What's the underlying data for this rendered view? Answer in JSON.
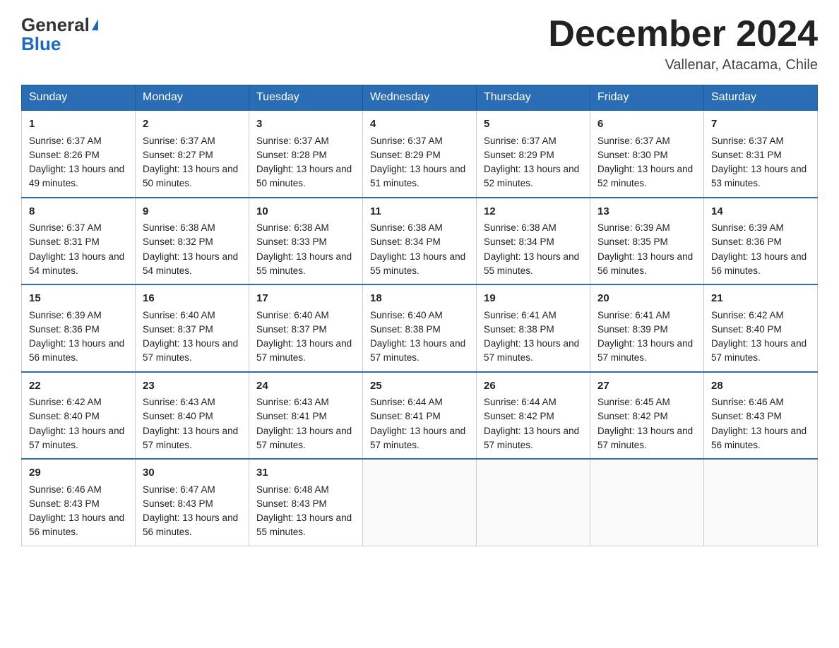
{
  "header": {
    "logo_general": "General",
    "logo_blue": "Blue",
    "month_title": "December 2024",
    "location": "Vallenar, Atacama, Chile"
  },
  "days_of_week": [
    "Sunday",
    "Monday",
    "Tuesday",
    "Wednesday",
    "Thursday",
    "Friday",
    "Saturday"
  ],
  "weeks": [
    [
      {
        "day": "1",
        "sunrise": "6:37 AM",
        "sunset": "8:26 PM",
        "daylight": "13 hours and 49 minutes."
      },
      {
        "day": "2",
        "sunrise": "6:37 AM",
        "sunset": "8:27 PM",
        "daylight": "13 hours and 50 minutes."
      },
      {
        "day": "3",
        "sunrise": "6:37 AM",
        "sunset": "8:28 PM",
        "daylight": "13 hours and 50 minutes."
      },
      {
        "day": "4",
        "sunrise": "6:37 AM",
        "sunset": "8:29 PM",
        "daylight": "13 hours and 51 minutes."
      },
      {
        "day": "5",
        "sunrise": "6:37 AM",
        "sunset": "8:29 PM",
        "daylight": "13 hours and 52 minutes."
      },
      {
        "day": "6",
        "sunrise": "6:37 AM",
        "sunset": "8:30 PM",
        "daylight": "13 hours and 52 minutes."
      },
      {
        "day": "7",
        "sunrise": "6:37 AM",
        "sunset": "8:31 PM",
        "daylight": "13 hours and 53 minutes."
      }
    ],
    [
      {
        "day": "8",
        "sunrise": "6:37 AM",
        "sunset": "8:31 PM",
        "daylight": "13 hours and 54 minutes."
      },
      {
        "day": "9",
        "sunrise": "6:38 AM",
        "sunset": "8:32 PM",
        "daylight": "13 hours and 54 minutes."
      },
      {
        "day": "10",
        "sunrise": "6:38 AM",
        "sunset": "8:33 PM",
        "daylight": "13 hours and 55 minutes."
      },
      {
        "day": "11",
        "sunrise": "6:38 AM",
        "sunset": "8:34 PM",
        "daylight": "13 hours and 55 minutes."
      },
      {
        "day": "12",
        "sunrise": "6:38 AM",
        "sunset": "8:34 PM",
        "daylight": "13 hours and 55 minutes."
      },
      {
        "day": "13",
        "sunrise": "6:39 AM",
        "sunset": "8:35 PM",
        "daylight": "13 hours and 56 minutes."
      },
      {
        "day": "14",
        "sunrise": "6:39 AM",
        "sunset": "8:36 PM",
        "daylight": "13 hours and 56 minutes."
      }
    ],
    [
      {
        "day": "15",
        "sunrise": "6:39 AM",
        "sunset": "8:36 PM",
        "daylight": "13 hours and 56 minutes."
      },
      {
        "day": "16",
        "sunrise": "6:40 AM",
        "sunset": "8:37 PM",
        "daylight": "13 hours and 57 minutes."
      },
      {
        "day": "17",
        "sunrise": "6:40 AM",
        "sunset": "8:37 PM",
        "daylight": "13 hours and 57 minutes."
      },
      {
        "day": "18",
        "sunrise": "6:40 AM",
        "sunset": "8:38 PM",
        "daylight": "13 hours and 57 minutes."
      },
      {
        "day": "19",
        "sunrise": "6:41 AM",
        "sunset": "8:38 PM",
        "daylight": "13 hours and 57 minutes."
      },
      {
        "day": "20",
        "sunrise": "6:41 AM",
        "sunset": "8:39 PM",
        "daylight": "13 hours and 57 minutes."
      },
      {
        "day": "21",
        "sunrise": "6:42 AM",
        "sunset": "8:40 PM",
        "daylight": "13 hours and 57 minutes."
      }
    ],
    [
      {
        "day": "22",
        "sunrise": "6:42 AM",
        "sunset": "8:40 PM",
        "daylight": "13 hours and 57 minutes."
      },
      {
        "day": "23",
        "sunrise": "6:43 AM",
        "sunset": "8:40 PM",
        "daylight": "13 hours and 57 minutes."
      },
      {
        "day": "24",
        "sunrise": "6:43 AM",
        "sunset": "8:41 PM",
        "daylight": "13 hours and 57 minutes."
      },
      {
        "day": "25",
        "sunrise": "6:44 AM",
        "sunset": "8:41 PM",
        "daylight": "13 hours and 57 minutes."
      },
      {
        "day": "26",
        "sunrise": "6:44 AM",
        "sunset": "8:42 PM",
        "daylight": "13 hours and 57 minutes."
      },
      {
        "day": "27",
        "sunrise": "6:45 AM",
        "sunset": "8:42 PM",
        "daylight": "13 hours and 57 minutes."
      },
      {
        "day": "28",
        "sunrise": "6:46 AM",
        "sunset": "8:43 PM",
        "daylight": "13 hours and 56 minutes."
      }
    ],
    [
      {
        "day": "29",
        "sunrise": "6:46 AM",
        "sunset": "8:43 PM",
        "daylight": "13 hours and 56 minutes."
      },
      {
        "day": "30",
        "sunrise": "6:47 AM",
        "sunset": "8:43 PM",
        "daylight": "13 hours and 56 minutes."
      },
      {
        "day": "31",
        "sunrise": "6:48 AM",
        "sunset": "8:43 PM",
        "daylight": "13 hours and 55 minutes."
      },
      null,
      null,
      null,
      null
    ]
  ],
  "labels": {
    "sunrise_prefix": "Sunrise: ",
    "sunset_prefix": "Sunset: ",
    "daylight_prefix": "Daylight: "
  }
}
